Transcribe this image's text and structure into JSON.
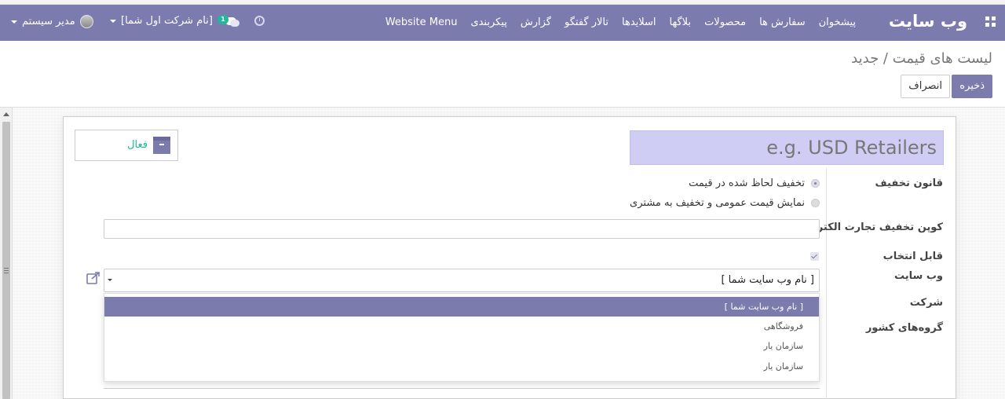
{
  "navbar": {
    "brand": "وب سایت",
    "menu": [
      "پیشخوان",
      "سفارش ها",
      "محصولات",
      "بلاگها",
      "اسلایدها",
      "تالار گفتگو",
      "گزارش",
      "پیکربندی",
      "Website Menu"
    ],
    "company": "[نام شرکت اول شما]",
    "chat_badge": "1",
    "user": "مدیر سیستم"
  },
  "breadcrumb": "لیست های قیمت / جدید",
  "buttons": {
    "save": "ذخیره",
    "discard": "انصراف"
  },
  "form": {
    "name_placeholder": "e.g. USD Retailers",
    "active_label": "فعال",
    "discount_policy_label": "قانون تخفیف",
    "discount_options": [
      {
        "label": "تخفیف لحاظ شده در قیمت",
        "checked": true
      },
      {
        "label": "نمایش قیمت عمومی و تخفیف به مشتری",
        "checked": false
      }
    ],
    "coupon_label": "کوپن تخفیف تجارت الکترونیک",
    "selectable_label": "قابل انتخاب",
    "selectable_checked": true,
    "website_label": "وب سایت",
    "website_value": "[ نام وب سایت شما ]",
    "company_label": "شرکت",
    "country_groups_label": "گروه‌های کشور"
  },
  "dropdown": {
    "items": [
      "[ نام وب سایت شما ]",
      "فروشگاهی",
      "سازمان یار",
      "سازمان یار"
    ],
    "active_index": 0
  },
  "colors": {
    "brand": "#7c7bad",
    "active_green": "#21b799",
    "name_field_bg": "#cfcdf4"
  },
  "icons": [
    "apps-grid-icon",
    "caret-down-icon",
    "chat-icon",
    "clock-icon",
    "archive-icon",
    "external-link-icon"
  ]
}
